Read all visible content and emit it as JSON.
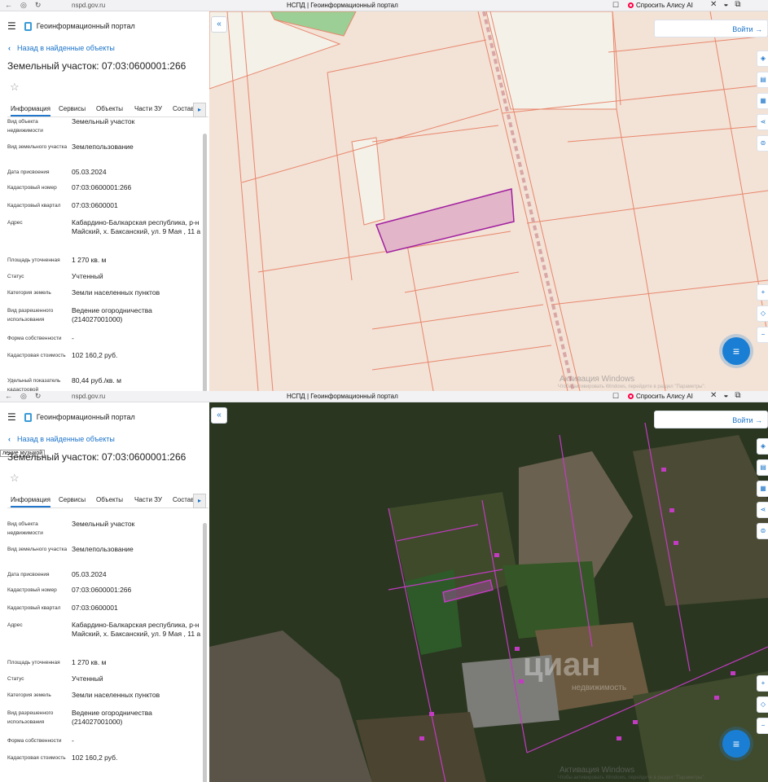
{
  "browser": {
    "url": "nspd.gov.ru",
    "window_title": "НСПД | Геоинформационный портал",
    "alice_label": "Спросить Алису AI"
  },
  "app": {
    "portal_title": "Геоинформационный портал",
    "back_label": "Назад в найденные объекты",
    "page_title": "Земельный участок: 07:03:0600001:266",
    "login_label": "Войти",
    "tooltip": "ление музыкой"
  },
  "tabs": [
    {
      "label": "Информация",
      "active": true
    },
    {
      "label": "Сервисы"
    },
    {
      "label": "Объекты"
    },
    {
      "label": "Части ЗУ"
    },
    {
      "label": "Состав"
    }
  ],
  "properties": [
    {
      "label": "Вид объекта недвижимости",
      "value": "Земельный участок"
    },
    {
      "label": "Вид земельного участка",
      "value": "Землепользование"
    },
    {
      "label": "Дата присвоения",
      "value": "05.03.2024"
    },
    {
      "label": "Кадастровый номер",
      "value": "07:03:0600001:266"
    },
    {
      "label": "Кадастровый квартал",
      "value": "07:03:0600001"
    },
    {
      "label": "Адрес",
      "value": "Кабардино-Балкарская республика, р-н Майский, х. Баксанский, ул. 9 Мая , 11 а"
    },
    {
      "label": "Площадь уточненная",
      "value": "1 270 кв. м"
    },
    {
      "label": "Статус",
      "value": "Учтенный"
    },
    {
      "label": "Категория земель",
      "value": "Земли населенных пунктов"
    },
    {
      "label": "Вид разрешенного использования",
      "value": "Ведение огородничества (214027001000)"
    },
    {
      "label": "Форма собственности",
      "value": "-"
    },
    {
      "label": "Кадастровая стоимость",
      "value": "102 160,2 руб."
    },
    {
      "label": "Удельный показатель кадастровой",
      "value": "80,44 руб./кв. м"
    }
  ],
  "map": {
    "watermark": "Активация Windows",
    "watermark_sub": "Чтобы активировать Windows, перейдите в раздел \"Параметры\".",
    "cian": "циан",
    "cian_sub": "недвижимость"
  },
  "colors": {
    "accent": "#1a73c9",
    "parcel_fill": "#f3e2d6",
    "parcel_line": "#e8876d",
    "selected_parcel": "#a020a0",
    "satellite_dark": "#2a3620"
  },
  "icons": [
    "menu-icon",
    "portal-logo-icon",
    "chevron-left-icon",
    "star-icon",
    "chevron-right-icon",
    "login-icon",
    "chat-icon",
    "layers-icon",
    "ruler-icon",
    "print-icon",
    "share-icon",
    "zoom-in-icon",
    "zoom-out-icon"
  ]
}
